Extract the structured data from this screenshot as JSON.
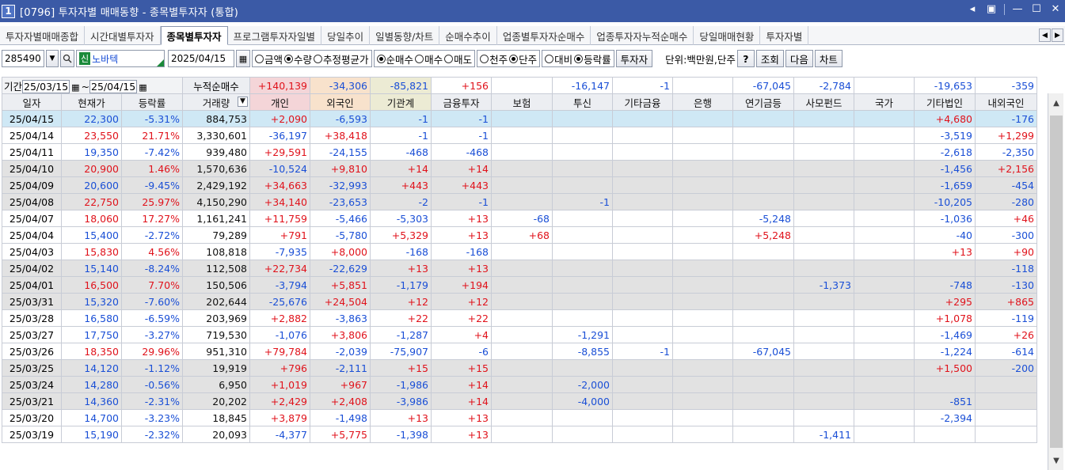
{
  "window": {
    "number": "1",
    "title": "[0796] 투자자별 매매동향 - 종목별투자자 (통합)"
  },
  "tabs": [
    {
      "label": "투자자별매매종합",
      "active": false
    },
    {
      "label": "시간대별투자자",
      "active": false
    },
    {
      "label": "종목별투자자",
      "active": true
    },
    {
      "label": "프로그램투자자일별",
      "active": false
    },
    {
      "label": "당일추이",
      "active": false
    },
    {
      "label": "일별동향/차트",
      "active": false
    },
    {
      "label": "순매수추이",
      "active": false
    },
    {
      "label": "업종별투자자순매수",
      "active": false
    },
    {
      "label": "업종투자자누적순매수",
      "active": false
    },
    {
      "label": "당일매매현황",
      "active": false
    },
    {
      "label": "투자자별",
      "active": false
    }
  ],
  "toolbar": {
    "code": "285490",
    "badge": "신",
    "stock_name": "노바텍",
    "date": "2025/04/15",
    "radio1": [
      {
        "label": "금액",
        "on": false
      },
      {
        "label": "수량",
        "on": true
      },
      {
        "label": "추정평균가",
        "on": false
      }
    ],
    "radio2": [
      {
        "label": "순매수",
        "on": true
      },
      {
        "label": "매수",
        "on": false
      },
      {
        "label": "매도",
        "on": false
      }
    ],
    "radio3": [
      {
        "label": "천주",
        "on": false
      },
      {
        "label": "단주",
        "on": true
      }
    ],
    "radio4": [
      {
        "label": "대비",
        "on": false
      },
      {
        "label": "등락률",
        "on": true
      }
    ],
    "investor_btn": "투자자",
    "unit_text": "단위:백만원,단주",
    "help_btn": "?",
    "query_btn": "조회",
    "next_btn": "다음",
    "chart_btn": "차트"
  },
  "summary": {
    "period_label": "기간",
    "from": "25/03/15",
    "to": "25/04/15",
    "tilde": "~",
    "cum_label": "누적순매수",
    "values": [
      "+140,139",
      "-34,306",
      "-85,821",
      "+156",
      "",
      "-16,147",
      "-1",
      "",
      "-67,045",
      "-2,784",
      "",
      "-19,653",
      "-359"
    ]
  },
  "columns": [
    "일자",
    "현재가",
    "등락률",
    "거래량",
    "개인",
    "외국인",
    "기관계",
    "금융투자",
    "보험",
    "투신",
    "기타금융",
    "은행",
    "연기금등",
    "사모펀드",
    "국가",
    "기타법인",
    "내외국인"
  ],
  "rows": [
    [
      "25/04/15",
      "22,300",
      "-5.31%",
      "884,753",
      "+2,090",
      "-6,593",
      "-1",
      "-1",
      "",
      "",
      "",
      "",
      "",
      "",
      "",
      "+4,680",
      "-176"
    ],
    [
      "25/04/14",
      "23,550",
      "21.71%",
      "3,330,601",
      "-36,197",
      "+38,418",
      "-1",
      "-1",
      "",
      "",
      "",
      "",
      "",
      "",
      "",
      "-3,519",
      "+1,299"
    ],
    [
      "25/04/11",
      "19,350",
      "-7.42%",
      "939,480",
      "+29,591",
      "-24,155",
      "-468",
      "-468",
      "",
      "",
      "",
      "",
      "",
      "",
      "",
      "-2,618",
      "-2,350"
    ],
    [
      "25/04/10",
      "20,900",
      "1.46%",
      "1,570,636",
      "-10,524",
      "+9,810",
      "+14",
      "+14",
      "",
      "",
      "",
      "",
      "",
      "",
      "",
      "-1,456",
      "+2,156"
    ],
    [
      "25/04/09",
      "20,600",
      "-9.45%",
      "2,429,192",
      "+34,663",
      "-32,993",
      "+443",
      "+443",
      "",
      "",
      "",
      "",
      "",
      "",
      "",
      "-1,659",
      "-454"
    ],
    [
      "25/04/08",
      "22,750",
      "25.97%",
      "4,150,290",
      "+34,140",
      "-23,653",
      "-2",
      "-1",
      "",
      "-1",
      "",
      "",
      "",
      "",
      "",
      "-10,205",
      "-280"
    ],
    [
      "25/04/07",
      "18,060",
      "17.27%",
      "1,161,241",
      "+11,759",
      "-5,466",
      "-5,303",
      "+13",
      "-68",
      "",
      "",
      "",
      "-5,248",
      "",
      "",
      "-1,036",
      "+46"
    ],
    [
      "25/04/04",
      "15,400",
      "-2.72%",
      "79,289",
      "+791",
      "-5,780",
      "+5,329",
      "+13",
      "+68",
      "",
      "",
      "",
      "+5,248",
      "",
      "",
      "-40",
      "-300"
    ],
    [
      "25/04/03",
      "15,830",
      "4.56%",
      "108,818",
      "-7,935",
      "+8,000",
      "-168",
      "-168",
      "",
      "",
      "",
      "",
      "",
      "",
      "",
      "+13",
      "+90"
    ],
    [
      "25/04/02",
      "15,140",
      "-8.24%",
      "112,508",
      "+22,734",
      "-22,629",
      "+13",
      "+13",
      "",
      "",
      "",
      "",
      "",
      "",
      "",
      "",
      "-118"
    ],
    [
      "25/04/01",
      "16,500",
      "7.70%",
      "150,506",
      "-3,794",
      "+5,851",
      "-1,179",
      "+194",
      "",
      "",
      "",
      "",
      "",
      "-1,373",
      "",
      "-748",
      "-130"
    ],
    [
      "25/03/31",
      "15,320",
      "-7.60%",
      "202,644",
      "-25,676",
      "+24,504",
      "+12",
      "+12",
      "",
      "",
      "",
      "",
      "",
      "",
      "",
      "+295",
      "+865"
    ],
    [
      "25/03/28",
      "16,580",
      "-6.59%",
      "203,969",
      "+2,882",
      "-3,863",
      "+22",
      "+22",
      "",
      "",
      "",
      "",
      "",
      "",
      "",
      "+1,078",
      "-119"
    ],
    [
      "25/03/27",
      "17,750",
      "-3.27%",
      "719,530",
      "-1,076",
      "+3,806",
      "-1,287",
      "+4",
      "",
      "-1,291",
      "",
      "",
      "",
      "",
      "",
      "-1,469",
      "+26"
    ],
    [
      "25/03/26",
      "18,350",
      "29.96%",
      "951,310",
      "+79,784",
      "-2,039",
      "-75,907",
      "-6",
      "",
      "-8,855",
      "-1",
      "",
      "-67,045",
      "",
      "",
      "-1,224",
      "-614"
    ],
    [
      "25/03/25",
      "14,120",
      "-1.12%",
      "19,919",
      "+796",
      "-2,111",
      "+15",
      "+15",
      "",
      "",
      "",
      "",
      "",
      "",
      "",
      "+1,500",
      "-200"
    ],
    [
      "25/03/24",
      "14,280",
      "-0.56%",
      "6,950",
      "+1,019",
      "+967",
      "-1,986",
      "+14",
      "",
      "-2,000",
      "",
      "",
      "",
      "",
      "",
      "",
      ""
    ],
    [
      "25/03/21",
      "14,360",
      "-2.31%",
      "20,202",
      "+2,429",
      "+2,408",
      "-3,986",
      "+14",
      "",
      "-4,000",
      "",
      "",
      "",
      "",
      "",
      "-851",
      ""
    ],
    [
      "25/03/20",
      "14,700",
      "-3.23%",
      "18,845",
      "+3,879",
      "-1,498",
      "+13",
      "+13",
      "",
      "",
      "",
      "",
      "",
      "",
      "",
      "-2,394",
      ""
    ],
    [
      "25/03/19",
      "15,190",
      "-2.32%",
      "20,093",
      "-4,377",
      "+5,775",
      "-1,398",
      "+13",
      "",
      "",
      "",
      "",
      "",
      "-1,411",
      "",
      "",
      ""
    ]
  ],
  "row_shading": [
    "sel",
    "w",
    "w",
    "g",
    "g",
    "g",
    "w",
    "w",
    "w",
    "g",
    "g",
    "g",
    "w",
    "w",
    "w",
    "g",
    "g",
    "g",
    "w",
    "w"
  ],
  "colors": {
    "up": "#e0121b",
    "down": "#1a4fd6",
    "titlebar": "#3b5aa6"
  }
}
